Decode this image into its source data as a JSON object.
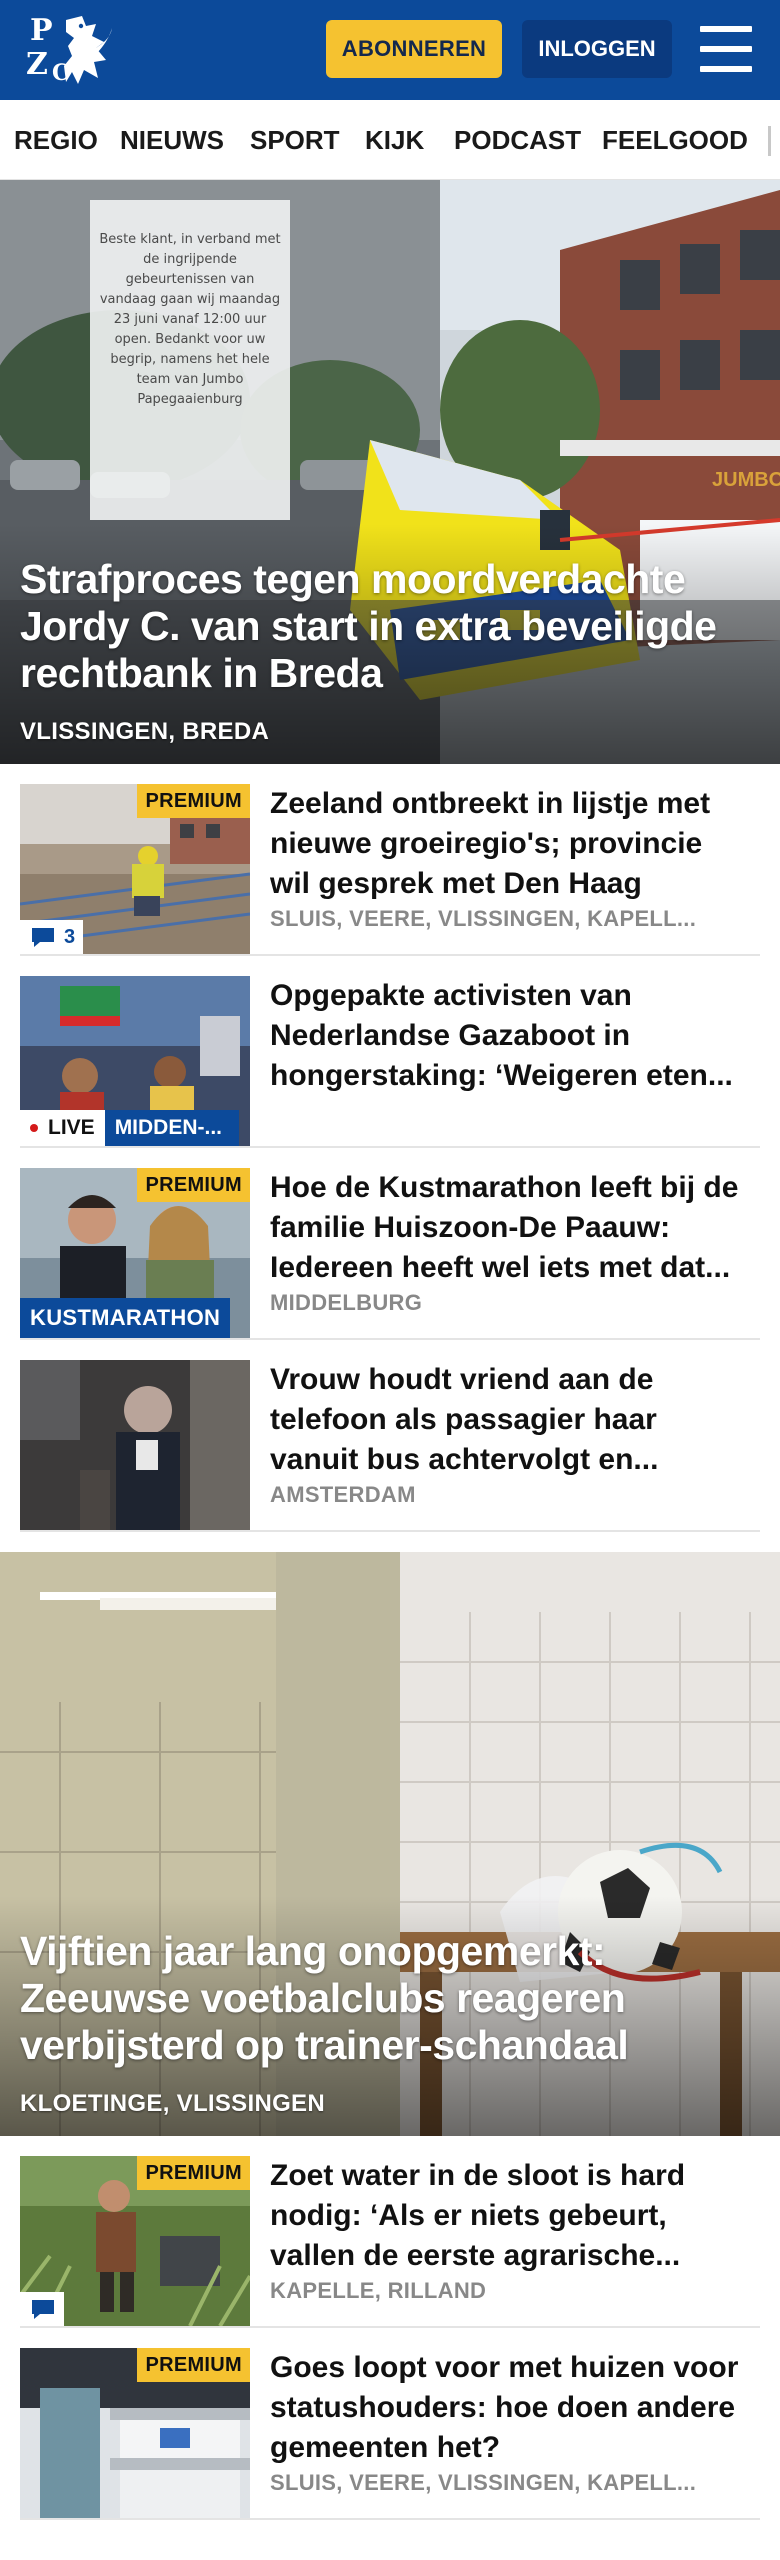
{
  "header": {
    "logo_letters": [
      "P",
      "Z",
      "C"
    ],
    "subscribe_label": "ABONNEREN",
    "login_label": "INLOGGEN"
  },
  "nav": {
    "items": [
      "REGIO",
      "NIEUWS",
      "SPORT",
      "KIJK",
      "PODCAST",
      "FEELGOOD"
    ]
  },
  "hero1": {
    "title": "Strafproces tegen moordverdachte Jordy C. van start in extra beveiligde rechtbank in Breda",
    "location": "VLISSINGEN, BREDA",
    "sign_text": "Beste klant, in verband met de ingrijpende gebeurtenissen van vandaag gaan wij maandag 23 juni vanaf 12:00 uur open. Bedankt voor uw begrip, namens het hele team van Jumbo Papegaaienburg",
    "store_sign": "JUMBO"
  },
  "articles1": [
    {
      "title": "Zeeland ontbreekt in lijstje met nieuwe groeiregio's; provincie wil gesprek met Den Haag",
      "location": "SLUIS, VEERE, VLISSINGEN, KAPELL...",
      "premium": "PREMIUM",
      "comments": "3"
    },
    {
      "title": "Opgepakte activisten van Nederlandse Gazaboot in hongerstaking: ‘Weigeren eten...",
      "live": "LIVE",
      "category": "MIDDEN-..."
    },
    {
      "title": "Hoe de Kustmarathon leeft bij de familie Huiszoon-De Paauw: Iedereen heeft wel iets met dat...",
      "location": "MIDDELBURG",
      "premium": "PREMIUM",
      "category": "KUSTMARATHON"
    },
    {
      "title": "Vrouw houdt vriend aan de telefoon als passagier haar vanuit bus achtervolgt en...",
      "location": "AMSTERDAM"
    }
  ],
  "hero2": {
    "title": "Vijftien jaar lang onopgemerkt: Zeeuwse voetbalclubs reageren verbijsterd op trainer-schandaal",
    "location": "KLOETINGE, VLISSINGEN"
  },
  "articles2": [
    {
      "title": "Zoet water in de sloot is hard nodig: ‘Als er niets gebeurt, vallen de eerste agrarische...",
      "location": "KAPELLE, RILLAND",
      "premium": "PREMIUM"
    },
    {
      "title": "Goes loopt voor met huizen voor statushouders: hoe doen andere gemeenten het?",
      "location": "SLUIS, VEERE, VLISSINGEN, KAPELL...",
      "premium": "PREMIUM"
    }
  ],
  "icons": {
    "logo": "pzc-logo",
    "menu": "hamburger-menu-icon",
    "comment": "comment-bubble-icon"
  },
  "colors": {
    "brand_blue": "#0c4a9a",
    "accent_yellow": "#f5c230",
    "live_red": "#d41a1a"
  }
}
